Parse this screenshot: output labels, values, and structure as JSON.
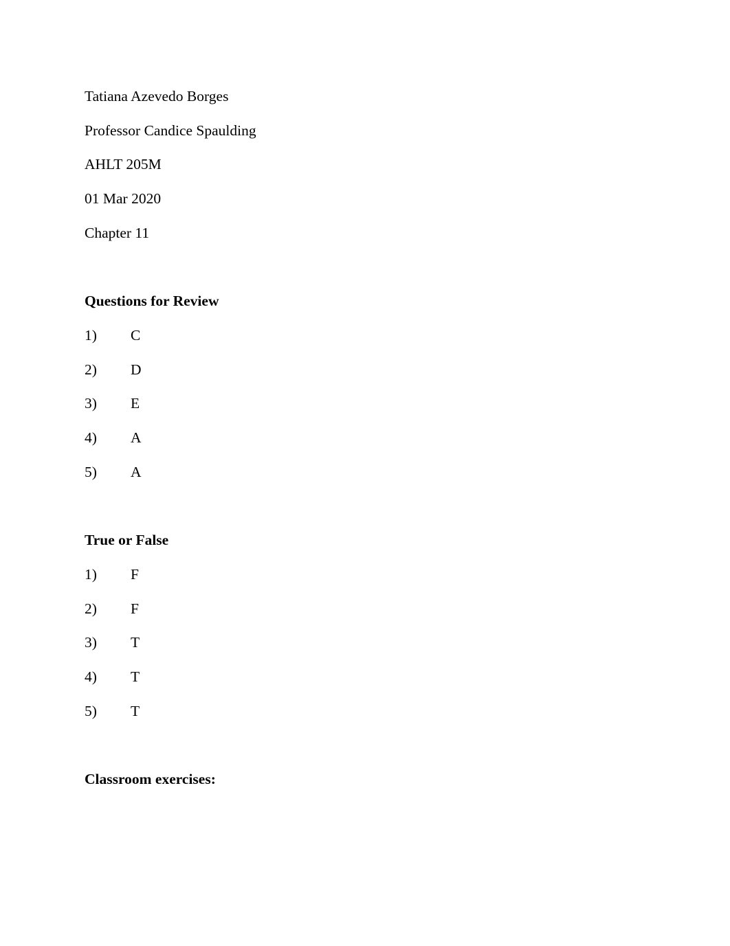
{
  "document": {
    "header_lines": [
      "Tatiana Azevedo Borges",
      "Professor Candice Spaulding",
      "AHLT 205M",
      "01 Mar 2020",
      "Chapter 11"
    ],
    "sections": [
      {
        "heading": "Questions for Review",
        "items": [
          {
            "number": "1)",
            "answer": "C"
          },
          {
            "number": "2)",
            "answer": "D"
          },
          {
            "number": "3)",
            "answer": "E"
          },
          {
            "number": "4)",
            "answer": "A"
          },
          {
            "number": "5)",
            "answer": "A"
          }
        ]
      },
      {
        "heading": "True or False",
        "items": [
          {
            "number": "1)",
            "answer": "F"
          },
          {
            "number": "2)",
            "answer": "F"
          },
          {
            "number": "3)",
            "answer": "T"
          },
          {
            "number": "4)",
            "answer": "T"
          },
          {
            "number": "5)",
            "answer": "T"
          }
        ]
      },
      {
        "heading": "Classroom exercises:",
        "items": []
      }
    ]
  },
  "colors": {
    "text": "#000000",
    "background": "#ffffff"
  }
}
